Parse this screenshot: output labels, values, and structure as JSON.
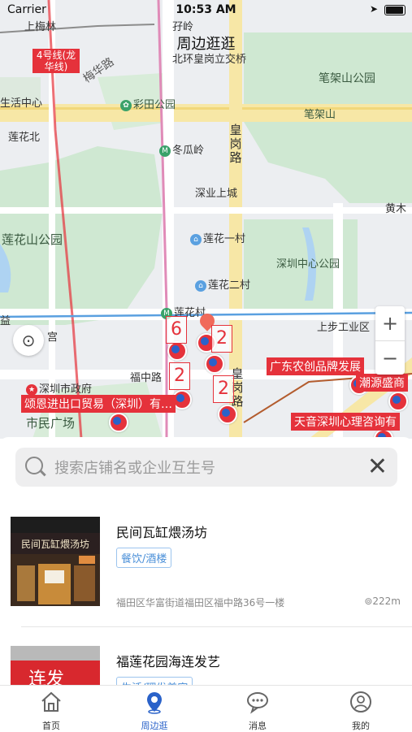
{
  "status_bar": {
    "carrier": "Carrier",
    "time": "10:53 AM"
  },
  "page_title": "周边逛逛",
  "map": {
    "labels": {
      "shangmeilin": "上梅林",
      "yuling": "孖岭",
      "interchange": "北环皇岗立交桥",
      "metro_line": "4号线(龙华线)",
      "meihua_road": "梅华路",
      "bijiashan_park": "笔架山公园",
      "life_center": "生活中心",
      "caitian_park": "彩田公园",
      "bijiashan": "笔架山",
      "lianhua_north": "莲花北",
      "donggualing": "冬瓜岭",
      "huanggang_road": "皇岗路",
      "shenye": "深业上城",
      "huangmu": "黄木",
      "lianhuashan_park": "莲花山公园",
      "lianhua_1": "莲花一村",
      "sz_center_park": "深圳中心公园",
      "lianhua_2": "莲花二村",
      "lianhua_village": "莲花村",
      "yi": "益",
      "gong": "宫",
      "shangbu": "上步工业区",
      "futian_road": "福中路",
      "huanggang_road2": "皇岗路",
      "gov": "深圳市政府",
      "civic_square": "市民广场"
    },
    "red_tags": {
      "tag1": "颂恩进出口贸易（深圳）有…",
      "tag2": "广东农创品牌发展",
      "tag3": "潮源盛商",
      "tag4": "天音深圳心理咨询有"
    },
    "clusters": {
      "c1": "6",
      "c2": "2",
      "c3": "2",
      "c4": "2"
    },
    "zoom_in": "+",
    "zoom_out": "−"
  },
  "search": {
    "placeholder": "搜索店铺名或企业互生号"
  },
  "stores": [
    {
      "name": "民间瓦缸煨汤坊",
      "tag": "餐饮/酒楼",
      "address": "福田区华富街道福田区福中路36号一楼",
      "distance": "222m",
      "sign_text": "民间瓦缸煨汤坊"
    },
    {
      "name": "福莲花园海连发艺",
      "tag": "生活/理发美容",
      "sign_text": "连发"
    }
  ],
  "tabs": [
    {
      "label": "首页",
      "icon": "home-icon"
    },
    {
      "label": "周边逛",
      "icon": "location-pin-icon"
    },
    {
      "label": "消息",
      "icon": "chat-bubble-icon"
    },
    {
      "label": "我的",
      "icon": "profile-icon"
    }
  ],
  "colors": {
    "accent": "#2a62c9",
    "tag_red": "#e5323b",
    "park_green": "#cfe8d2"
  }
}
